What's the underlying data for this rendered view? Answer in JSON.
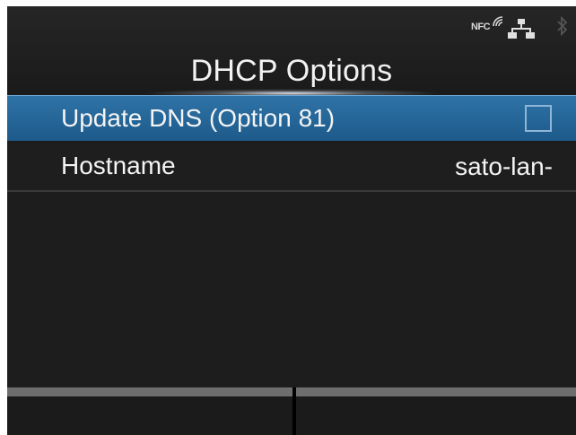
{
  "header": {
    "title": "DHCP Options",
    "status_icons": {
      "nfc_label": "NFC",
      "nfc_icon": "nfc-waves-icon",
      "network_icon": "network-icon",
      "bluetooth_icon": "bluetooth-icon"
    }
  },
  "menu": {
    "items": [
      {
        "label": "Update DNS (Option 81)",
        "control": "checkbox",
        "checked": false,
        "selected": true
      },
      {
        "label": "Hostname",
        "value": "sato-lan-",
        "selected": false
      }
    ]
  },
  "softkeys": {
    "left_label": "",
    "right_label": ""
  },
  "colors": {
    "selected_row": "#2f73a6",
    "background": "#1d1d1d",
    "text": "#f4f4f4"
  }
}
